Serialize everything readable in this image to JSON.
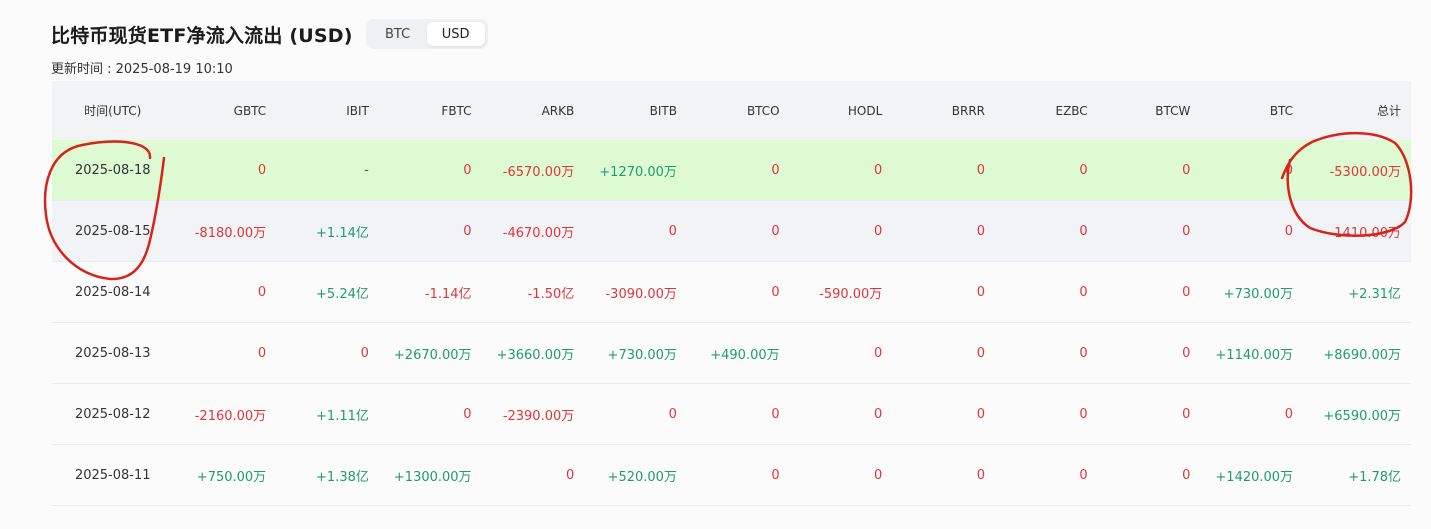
{
  "title": "比特币现货ETF净流入流出 (USD)",
  "toggle": {
    "options": [
      "BTC",
      "USD"
    ],
    "active": "USD"
  },
  "updated": "更新时间 : 2025-08-19 10:10",
  "table": {
    "columns": [
      "时间(UTC)",
      "GBTC",
      "IBIT",
      "FBTC",
      "ARKB",
      "BITB",
      "BTCO",
      "HODL",
      "BRRR",
      "EZBC",
      "BTCW",
      "BTC",
      "总计"
    ],
    "rows": [
      [
        "2025-08-18",
        "0",
        "-",
        "0",
        "-6570.00万",
        "+1270.00万",
        "0",
        "0",
        "0",
        "0",
        "0",
        "0",
        "-5300.00万"
      ],
      [
        "2025-08-15",
        "-8180.00万",
        "+1.14亿",
        "0",
        "-4670.00万",
        "0",
        "0",
        "0",
        "0",
        "0",
        "0",
        "0",
        "-1410.00万"
      ],
      [
        "2025-08-14",
        "0",
        "+5.24亿",
        "-1.14亿",
        "-1.50亿",
        "-3090.00万",
        "0",
        "-590.00万",
        "0",
        "0",
        "0",
        "+730.00万",
        "+2.31亿"
      ],
      [
        "2025-08-13",
        "0",
        "0",
        "+2670.00万",
        "+3660.00万",
        "+730.00万",
        "+490.00万",
        "0",
        "0",
        "0",
        "0",
        "+1140.00万",
        "+8690.00万"
      ],
      [
        "2025-08-12",
        "-2160.00万",
        "+1.11亿",
        "0",
        "-2390.00万",
        "0",
        "0",
        "0",
        "0",
        "0",
        "0",
        "0",
        "+6590.00万"
      ],
      [
        "2025-08-11",
        "+750.00万",
        "+1.38亿",
        "+1300.00万",
        "0",
        "+520.00万",
        "0",
        "0",
        "0",
        "0",
        "0",
        "+1420.00万",
        "+1.78亿"
      ]
    ]
  },
  "colors": {
    "positive": "#1f9d6a",
    "negative": "#e0353b",
    "highlight_row": "#ddfad2",
    "annotation": "#d8231b"
  }
}
